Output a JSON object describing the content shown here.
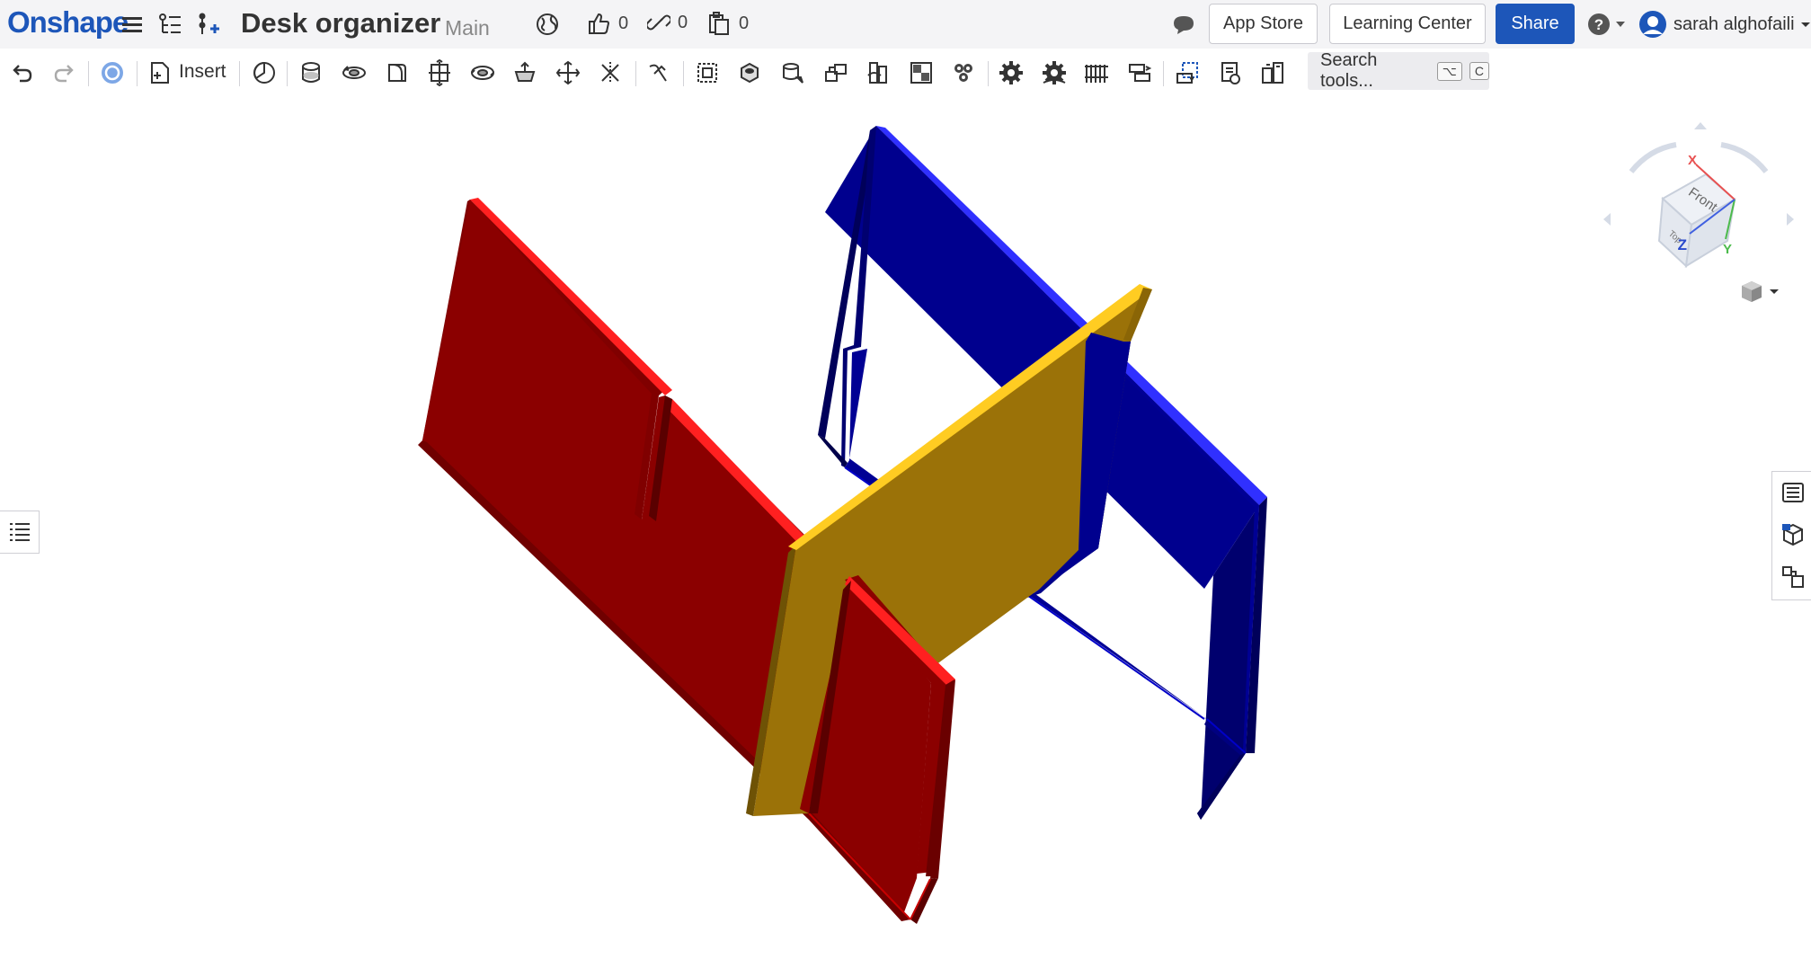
{
  "app": {
    "logo": "Onshape",
    "document_title": "Desk organizer",
    "branch": "Main"
  },
  "stats": {
    "likes": "0",
    "links": "0",
    "copies": "0"
  },
  "header_buttons": {
    "app_store": "App Store",
    "learning_center": "Learning Center",
    "share": "Share"
  },
  "user": {
    "name": "sarah alghofaili"
  },
  "toolbar": {
    "insert_label": "Insert",
    "search_placeholder": "Search tools...",
    "search_shortcut_1": "⌥",
    "search_shortcut_2": "C"
  },
  "viewcube": {
    "face_front": "Front",
    "face_top": "Top",
    "axis_x": "X",
    "axis_y": "Y",
    "axis_z": "Z"
  },
  "colors": {
    "brand": "#1d56b9",
    "part_red": "#8b0000",
    "part_red_edge": "#ff2020",
    "part_blue": "#00008e",
    "part_blue_edge": "#3030ff",
    "part_yellow": "#9b7208",
    "part_yellow_edge": "#ffcc22"
  }
}
